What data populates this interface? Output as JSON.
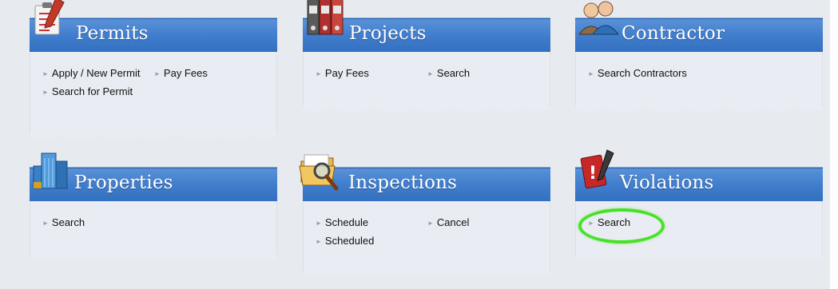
{
  "cards": {
    "permits": {
      "title": "Permits",
      "icon": "clipboard-icon",
      "links": [
        "Apply / New Permit",
        "Pay Fees",
        "Search for Permit"
      ]
    },
    "projects": {
      "title": "Projects",
      "icon": "binders-icon",
      "links": [
        "Pay Fees",
        "Search"
      ]
    },
    "contractor": {
      "title": "Contractor",
      "icon": "people-icon",
      "links": [
        "Search Contractors"
      ]
    },
    "properties": {
      "title": "Properties",
      "icon": "building-icon",
      "links": [
        "Search"
      ]
    },
    "inspections": {
      "title": "Inspections",
      "icon": "folder-magnifier-icon",
      "links": [
        "Schedule",
        "Cancel",
        "Scheduled"
      ]
    },
    "violations": {
      "title": "Violations",
      "icon": "alert-book-icon",
      "links": [
        "Search"
      ]
    }
  },
  "colors": {
    "header_blue": "#3f7ccc",
    "background": "#e7eaef",
    "highlight_circle": "#49e02a"
  }
}
